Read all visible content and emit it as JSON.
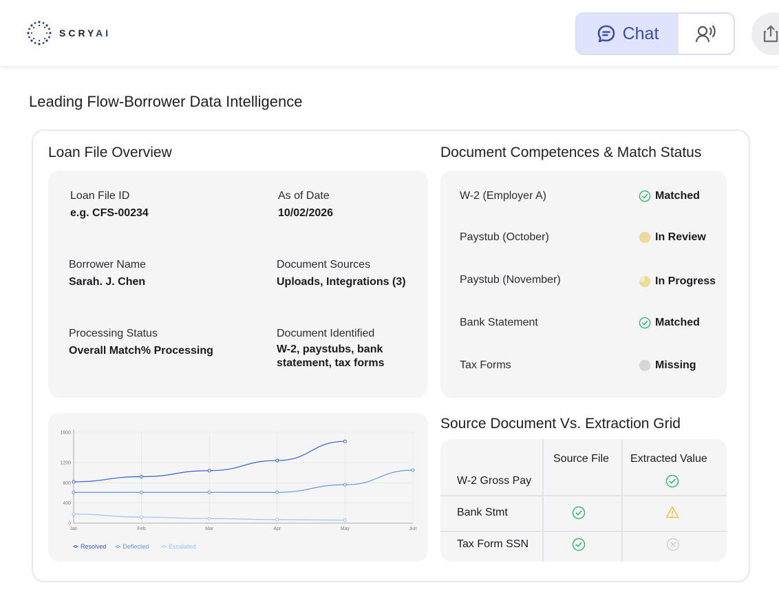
{
  "header": {
    "logo_text_main": "SCRY",
    "logo_text_ai": "AI",
    "chat_label": "Chat"
  },
  "page_title": "Leading Flow-Borrower Data Intelligence",
  "loan_overview": {
    "title": "Loan File Overview",
    "fields": [
      {
        "label": "Loan File ID",
        "value": "e.g. CFS-00234"
      },
      {
        "label": "As of Date",
        "value": "10/02/2026"
      },
      {
        "label": "Borrower Name",
        "value": "Sarah. J. Chen"
      },
      {
        "label": "Document Sources",
        "value": "Uploads, Integrations (3)"
      },
      {
        "label": "Processing Status",
        "value": "Overall Match% Processing"
      },
      {
        "label": "Document Identified",
        "value_line1": "W-2, paystubs, bank",
        "value_line2": "statement, tax forms"
      }
    ]
  },
  "doc_status": {
    "title": "Document Competences & Match Status",
    "rows": [
      {
        "label": "W-2 (Employer A)",
        "status": "Matched",
        "icon": "check-circle-icon"
      },
      {
        "label": "Paystub (October)",
        "status": "In Review",
        "icon": "yellow-dot-icon"
      },
      {
        "label": "Paystub (November)",
        "status": "In Progress",
        "icon": "half-pie-icon"
      },
      {
        "label": "Bank Statement",
        "status": "Matched",
        "icon": "check-circle-icon"
      },
      {
        "label": "Tax Forms",
        "status": "Missing",
        "icon": "gray-dot-icon"
      }
    ]
  },
  "extraction_grid": {
    "title": "Source Document Vs. Extraction Grid",
    "headers": [
      "Source File",
      "Extracted Value"
    ],
    "rows": [
      {
        "label": "W-2 Gross Pay",
        "source": "",
        "extracted": "check-circle-icon"
      },
      {
        "label": "Bank Stmt",
        "source": "check-circle-icon",
        "extracted": "warning-icon"
      },
      {
        "label": "Tax Form SSN",
        "source": "check-circle-icon",
        "extracted": "x-circle-icon"
      }
    ]
  },
  "colors": {
    "accent": "#3b4ba9",
    "matched": "#3cb371",
    "in_review": "#ecdc9a",
    "missing": "#d6d6d9",
    "warning": "#e3c24a",
    "resolved": "#2f5fd6",
    "deflected": "#5d97ea",
    "escalated": "#9cc4f2"
  },
  "chart_data": {
    "type": "line",
    "categories": [
      "Jan",
      "Feb",
      "Mar",
      "Apr",
      "May",
      "Jun"
    ],
    "ylim": [
      0,
      1800
    ],
    "yticks": [
      0,
      400,
      800,
      1200,
      1800
    ],
    "series": [
      {
        "name": "Resolved",
        "values": [
          820,
          920,
          1040,
          1240,
          1620,
          null
        ]
      },
      {
        "name": "Deflected",
        "values": [
          610,
          610,
          610,
          610,
          760,
          1050
        ]
      },
      {
        "name": "Escalated",
        "values": [
          180,
          120,
          90,
          70,
          60,
          null
        ]
      }
    ],
    "legend_position": "bottom-left"
  }
}
